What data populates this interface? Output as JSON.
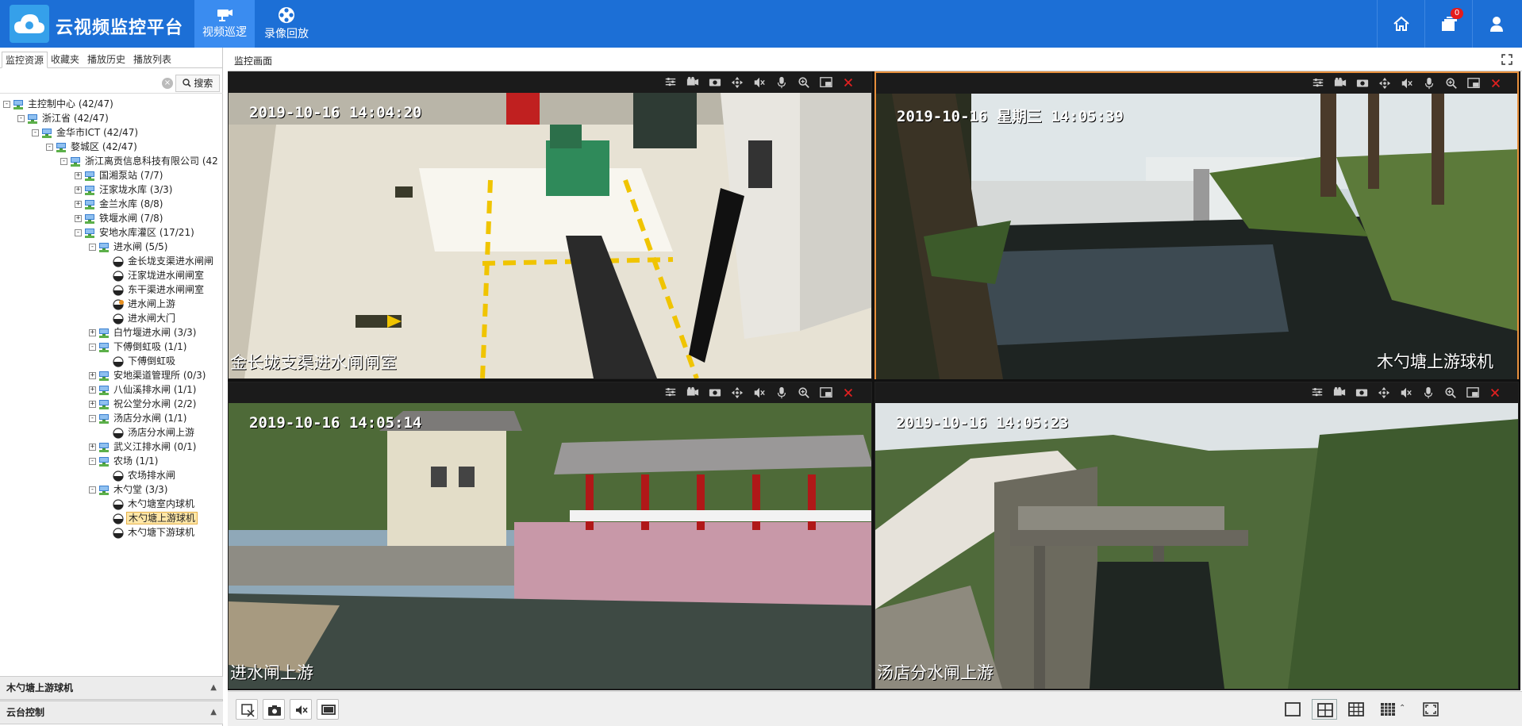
{
  "header": {
    "app_title": "云视频监控平台",
    "nav": [
      {
        "label": "视频巡逻",
        "icon": "camera-icon",
        "active": true
      },
      {
        "label": "录像回放",
        "icon": "film-reel-icon",
        "active": false
      }
    ],
    "cart_badge": "0",
    "colors": {
      "bar": "#1c6fd6",
      "active_nav": "#3a8cf0"
    }
  },
  "left_panel": {
    "tabs": [
      "监控资源",
      "收藏夹",
      "播放历史",
      "播放列表"
    ],
    "active_tab": "监控资源",
    "search": {
      "value": "",
      "button_label": "搜索"
    },
    "tree": [
      {
        "label": "主控制中心 (42/47)",
        "level": 0,
        "toggle": "-",
        "icon": "server-icon"
      },
      {
        "label": "浙江省 (42/47)",
        "level": 1,
        "toggle": "-",
        "icon": "server-icon"
      },
      {
        "label": "金华市ICT (42/47)",
        "level": 2,
        "toggle": "-",
        "icon": "server-icon"
      },
      {
        "label": "婺城区 (42/47)",
        "level": 3,
        "toggle": "-",
        "icon": "server-icon"
      },
      {
        "label": "浙江离贡信息科技有限公司 (42",
        "level": 4,
        "toggle": "-",
        "icon": "server-icon"
      },
      {
        "label": "国湘泵站 (7/7)",
        "level": 5,
        "toggle": "+",
        "icon": "server-icon"
      },
      {
        "label": "汪家垅水库 (3/3)",
        "level": 5,
        "toggle": "+",
        "icon": "server-icon"
      },
      {
        "label": "金兰水库 (8/8)",
        "level": 5,
        "toggle": "+",
        "icon": "server-icon"
      },
      {
        "label": "铁堰水闸 (7/8)",
        "level": 5,
        "toggle": "+",
        "icon": "server-icon"
      },
      {
        "label": "安地水库灌区 (17/21)",
        "level": 5,
        "toggle": "-",
        "icon": "server-icon"
      },
      {
        "label": "进水闸 (5/5)",
        "level": 6,
        "toggle": "-",
        "icon": "server-icon"
      },
      {
        "label": "金长垅支渠进水闸闸",
        "level": 7,
        "toggle": "",
        "icon": "camera-dome-icon"
      },
      {
        "label": "汪家垅进水闸闸室",
        "level": 7,
        "toggle": "",
        "icon": "camera-dome-icon"
      },
      {
        "label": "东干渠进水闸闸室",
        "level": 7,
        "toggle": "",
        "icon": "camera-dome-icon"
      },
      {
        "label": "进水闸上游",
        "level": 7,
        "toggle": "",
        "icon": "camera-dome-warn-icon"
      },
      {
        "label": "进水闸大门",
        "level": 7,
        "toggle": "",
        "icon": "camera-dome-icon"
      },
      {
        "label": "白竹堰进水闸 (3/3)",
        "level": 6,
        "toggle": "+",
        "icon": "server-icon"
      },
      {
        "label": "下傅倒虹吸 (1/1)",
        "level": 6,
        "toggle": "-",
        "icon": "server-icon"
      },
      {
        "label": "下傅倒虹吸",
        "level": 7,
        "toggle": "",
        "icon": "camera-dome-icon"
      },
      {
        "label": "安地渠道管理所 (0/3)",
        "level": 6,
        "toggle": "+",
        "icon": "server-icon"
      },
      {
        "label": "八仙溪排水闸 (1/1)",
        "level": 6,
        "toggle": "+",
        "icon": "server-icon"
      },
      {
        "label": "祝公堂分水闸 (2/2)",
        "level": 6,
        "toggle": "+",
        "icon": "server-icon"
      },
      {
        "label": "汤店分水闸 (1/1)",
        "level": 6,
        "toggle": "-",
        "icon": "server-icon"
      },
      {
        "label": "汤店分水闸上游",
        "level": 7,
        "toggle": "",
        "icon": "camera-dome-icon"
      },
      {
        "label": "武义江排水闸 (0/1)",
        "level": 6,
        "toggle": "+",
        "icon": "server-icon"
      },
      {
        "label": "农场 (1/1)",
        "level": 6,
        "toggle": "-",
        "icon": "server-icon"
      },
      {
        "label": "农场排水闸",
        "level": 7,
        "toggle": "",
        "icon": "camera-dome-icon"
      },
      {
        "label": "木勺堂 (3/3)",
        "level": 6,
        "toggle": "-",
        "icon": "server-icon"
      },
      {
        "label": "木勺塘室内球机",
        "level": 7,
        "toggle": "",
        "icon": "camera-dome-icon"
      },
      {
        "label": "木勺塘上游球机",
        "level": 7,
        "toggle": "",
        "icon": "camera-dome-icon",
        "selected": true
      },
      {
        "label": "木勺塘下游球机",
        "level": 7,
        "toggle": "",
        "icon": "camera-dome-icon"
      }
    ],
    "accordion": [
      "木勺塘上游球机",
      "云台控制"
    ]
  },
  "main": {
    "title": "监控画面",
    "videos": [
      {
        "timestamp": "2019-10-16 14:04:20",
        "label": "金长垅支渠进水闸闸室",
        "label_side": "left",
        "selected": false,
        "scene": "indoor"
      },
      {
        "timestamp": "2019-10-16 星期三 14:05:39",
        "label": "木勺塘上游球机",
        "label_side": "right",
        "selected": true,
        "scene": "river"
      },
      {
        "timestamp": "2019-10-16 14:05:14",
        "label": "进水闸上游",
        "label_side": "left",
        "selected": false,
        "scene": "building"
      },
      {
        "timestamp": "2019-10-16 14:05:23",
        "label": "汤店分水闸上游",
        "label_side": "left",
        "selected": false,
        "scene": "road"
      }
    ],
    "video_tools": [
      "settings-icon",
      "record-icon",
      "snapshot-icon",
      "ptz-icon",
      "mute-icon",
      "mic-icon",
      "zoom-icon",
      "window-icon",
      "close-icon"
    ]
  }
}
